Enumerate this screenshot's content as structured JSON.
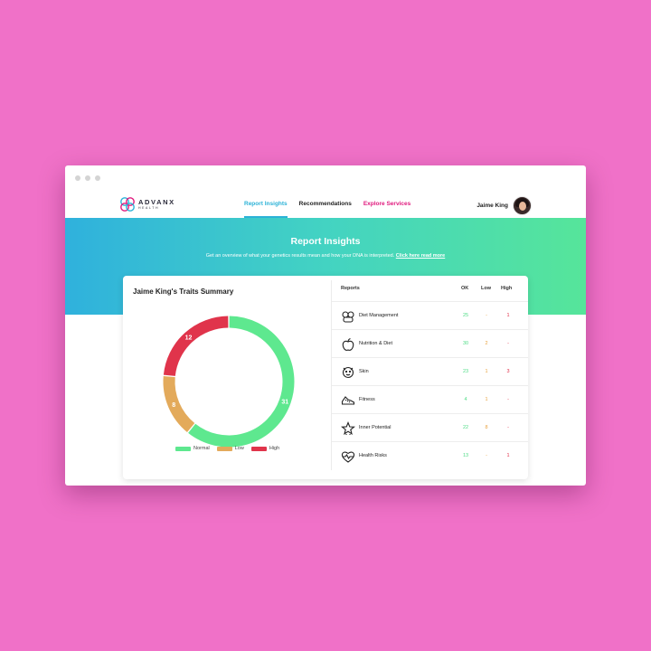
{
  "window": {
    "controls": [
      "close",
      "minimize",
      "maximize"
    ]
  },
  "brand": {
    "name": "ADVANX",
    "sub": "HEALTH"
  },
  "nav": {
    "items": [
      {
        "label": "Report Insights",
        "active": true
      },
      {
        "label": "Recommendations",
        "active": false
      },
      {
        "label": "Explore Services",
        "active": false,
        "accent": true
      }
    ]
  },
  "user": {
    "name": "Jaime King"
  },
  "hero": {
    "title": "Report Insights",
    "subtitle": "Get an overview of what your genetics results mean and how your DNA is interpreted.",
    "link": "Click here read more"
  },
  "summary": {
    "title": "Jaime King's Traits Summary",
    "legend": [
      "Normal",
      "Low",
      "High"
    ]
  },
  "chart_data": {
    "type": "pie",
    "categories": [
      "Normal",
      "Low",
      "High"
    ],
    "values": [
      31,
      8,
      12
    ],
    "colors": [
      "#5ee88f",
      "#e3aa5b",
      "#e0344b"
    ],
    "title": "Jaime King's Traits Summary",
    "legend": "bottom"
  },
  "table": {
    "headers": {
      "reports": "Reports",
      "ok": "OK",
      "low": "Low",
      "high": "High"
    },
    "rows": [
      {
        "icon": "diet-management-icon",
        "label": "Diet Management",
        "ok": "25",
        "low": "-",
        "high": "1"
      },
      {
        "icon": "apple-icon",
        "label": "Nutrition & Diet",
        "ok": "30",
        "low": "2",
        "high": "-"
      },
      {
        "icon": "skin-icon",
        "label": "Skin",
        "ok": "23",
        "low": "1",
        "high": "3"
      },
      {
        "icon": "shoe-icon",
        "label": "Fitness",
        "ok": "4",
        "low": "1",
        "high": "-"
      },
      {
        "icon": "star-icon",
        "label": "Inner Potential",
        "ok": "22",
        "low": "8",
        "high": "-"
      },
      {
        "icon": "heart-pulse-icon",
        "label": "Health Risks",
        "ok": "13",
        "low": "-",
        "high": "1"
      }
    ]
  },
  "colors": {
    "accent": "#2bb2d7",
    "brand_pink": "#e0197d",
    "ok": "#4fdc86",
    "low": "#e9a23f",
    "high": "#e02b45"
  }
}
